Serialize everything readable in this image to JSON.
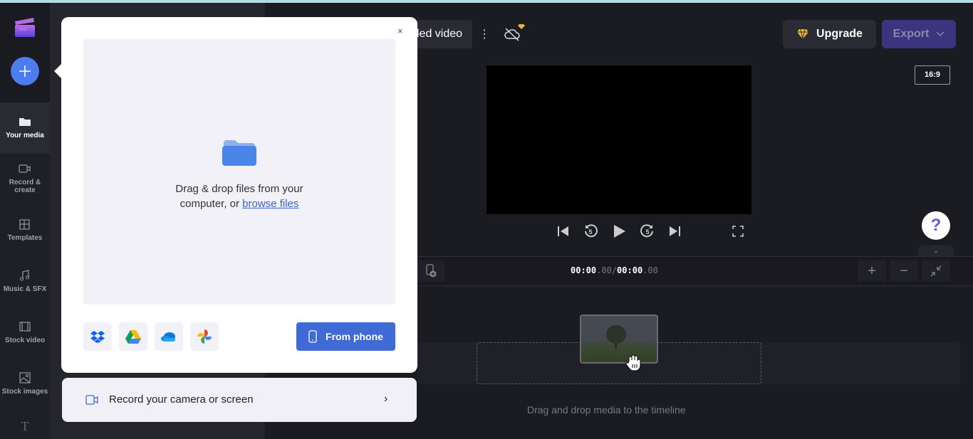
{
  "app": {
    "title_partial": "led video",
    "accent": "#4b7cf0"
  },
  "sidebar": {
    "add_button": "Add media",
    "items": [
      {
        "label": "Your media",
        "icon": "folder-icon",
        "active": true
      },
      {
        "label": "Record &\ncreate",
        "icon": "video-camera-icon"
      },
      {
        "label": "Templates",
        "icon": "templates-icon"
      },
      {
        "label": "Music & SFX",
        "icon": "music-note-icon"
      },
      {
        "label": "Stock video",
        "icon": "film-icon"
      },
      {
        "label": "Stock images",
        "icon": "image-icon"
      },
      {
        "label": "",
        "icon": "text-icon"
      }
    ]
  },
  "header": {
    "title": "led video",
    "more_icon": "⋮",
    "upgrade_label": "Upgrade",
    "export_label": "Export",
    "aspect_ratio": "16:9"
  },
  "player": {
    "controls": [
      "skip-back",
      "rewind-5",
      "play",
      "forward-5",
      "skip-forward",
      "fullscreen"
    ],
    "rewind_seconds": "5",
    "forward_seconds": "5"
  },
  "timeline": {
    "current_time_main": "00:00",
    "current_time_frac": ".00",
    "separator": "/",
    "total_time_main": "00:00",
    "total_time_frac": ".00",
    "zoom_in": "+",
    "zoom_out": "−",
    "hint": "Drag and drop media to the timeline"
  },
  "help": {
    "label": "?",
    "collapse": "⌄"
  },
  "upload_popup": {
    "close": "×",
    "drop_text_line1": "Drag & drop files from your",
    "drop_text_line2": "computer, or ",
    "browse_link": "browse files",
    "sources": [
      "Dropbox",
      "Google Drive",
      "OneDrive",
      "Google Photos"
    ],
    "from_phone_label": "From phone"
  },
  "record_option": {
    "label": "Record your camera or screen",
    "chevron": "›"
  }
}
